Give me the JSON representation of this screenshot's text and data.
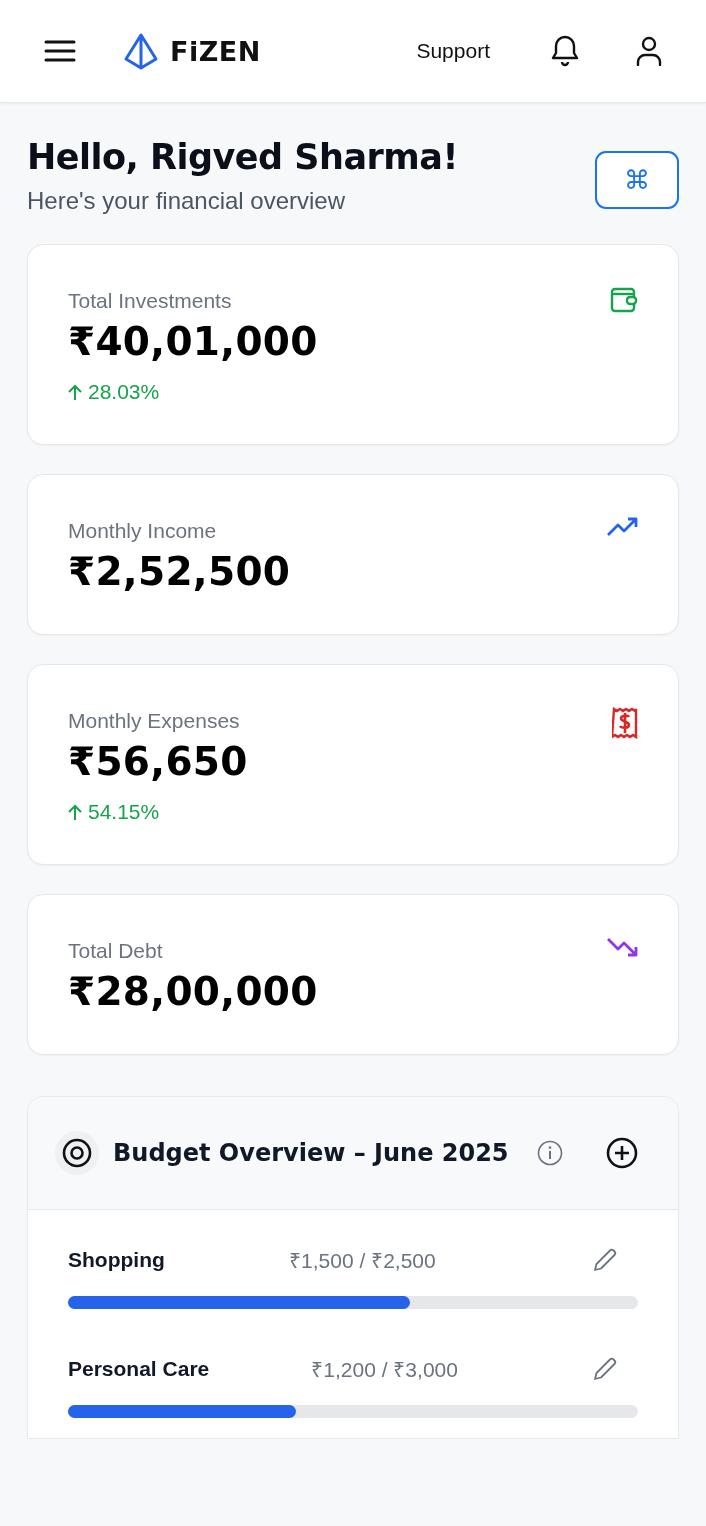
{
  "header": {
    "brand": "FiZEN",
    "support_link": "Support"
  },
  "greeting": {
    "title": "Hello, Rigved Sharma!",
    "subtitle": "Here's your financial overview",
    "shortcut_button": "⌘"
  },
  "stat_cards": [
    {
      "label": "Total Investments",
      "value": "₹40,01,000",
      "change": "28.03%",
      "kind": "wallet",
      "color": "#16a34a"
    },
    {
      "label": "Monthly Income",
      "value": "₹2,52,500",
      "kind": "trend-up",
      "color": "#2563eb"
    },
    {
      "label": "Monthly Expenses",
      "value": "₹56,650",
      "change": "54.15%",
      "kind": "receipt",
      "color": "#dc2626"
    },
    {
      "label": "Total Debt",
      "value": "₹28,00,000",
      "kind": "trend-down",
      "color": "#9333ea"
    }
  ],
  "budget": {
    "title": "Budget Overview – June 2025",
    "items": [
      {
        "name": "Shopping",
        "amount": "₹1,500 / ₹2,500",
        "level": 0.6
      },
      {
        "name": "Personal Care",
        "amount": "₹1,200 / ₹3,000",
        "level": 0.4
      }
    ]
  }
}
